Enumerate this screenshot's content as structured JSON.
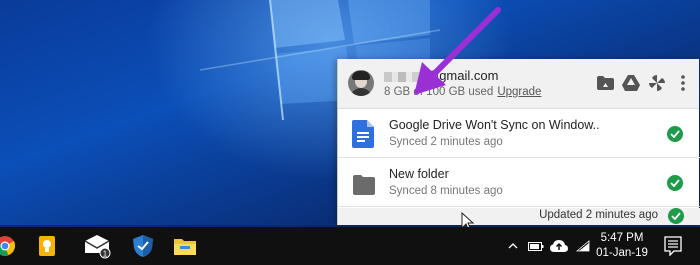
{
  "popup": {
    "email_suffix": "@gmail.com",
    "storage_text": "8 GB of 100 GB used",
    "upgrade_label": "Upgrade",
    "files": [
      {
        "name": "Google Drive Won't Sync on Window..",
        "status": "Synced 2 minutes ago",
        "icon": "google-docs-icon"
      },
      {
        "name": "New folder",
        "status": "Synced 8 minutes ago",
        "icon": "folder-icon"
      }
    ],
    "footer_status": "Updated 2 minutes ago",
    "header_icons": [
      "drive-folder-icon",
      "google-drive-icon",
      "google-photos-icon",
      "more-vertical-icon"
    ]
  },
  "taskbar": {
    "badge_count": "1",
    "time": "5:47 PM",
    "date": "01-Jan-19"
  },
  "colors": {
    "check_green": "#1e9b48",
    "arrow_purple": "#9b2fd6"
  }
}
